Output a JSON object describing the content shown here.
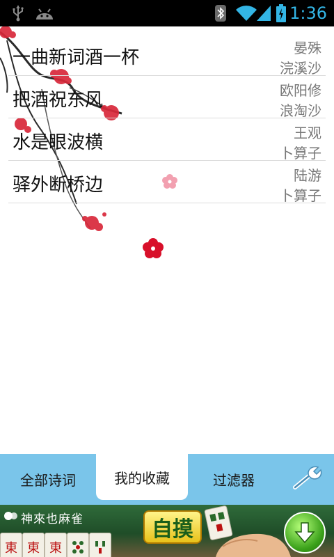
{
  "status_bar": {
    "time": "1:36",
    "icons": [
      "usb-icon",
      "android-debug-icon",
      "bluetooth-icon",
      "wifi-icon",
      "signal-icon",
      "battery-charging-icon"
    ],
    "accent_color": "#33b5e5"
  },
  "poems": [
    {
      "title": "一曲新词酒一杯",
      "author": "晏殊",
      "tune": "浣溪沙"
    },
    {
      "title": "把酒祝东风",
      "author": "欧阳修",
      "tune": "浪淘沙"
    },
    {
      "title": "水是眼波横",
      "author": "王观",
      "tune": "卜算子"
    },
    {
      "title": "驿外断桥边",
      "author": "陆游",
      "tune": "卜算子"
    }
  ],
  "tabs": {
    "all": "全部诗词",
    "favorites": "我的收藏",
    "filter": "过滤器",
    "settings_icon": "wrench-icon",
    "selected": "favorites",
    "bar_color": "#7ac5ea"
  },
  "ad": {
    "title": "神來也麻雀",
    "tiles": [
      "東",
      "東",
      "東"
    ],
    "badge": "自摸",
    "download_icon": "download-arrow-icon"
  }
}
